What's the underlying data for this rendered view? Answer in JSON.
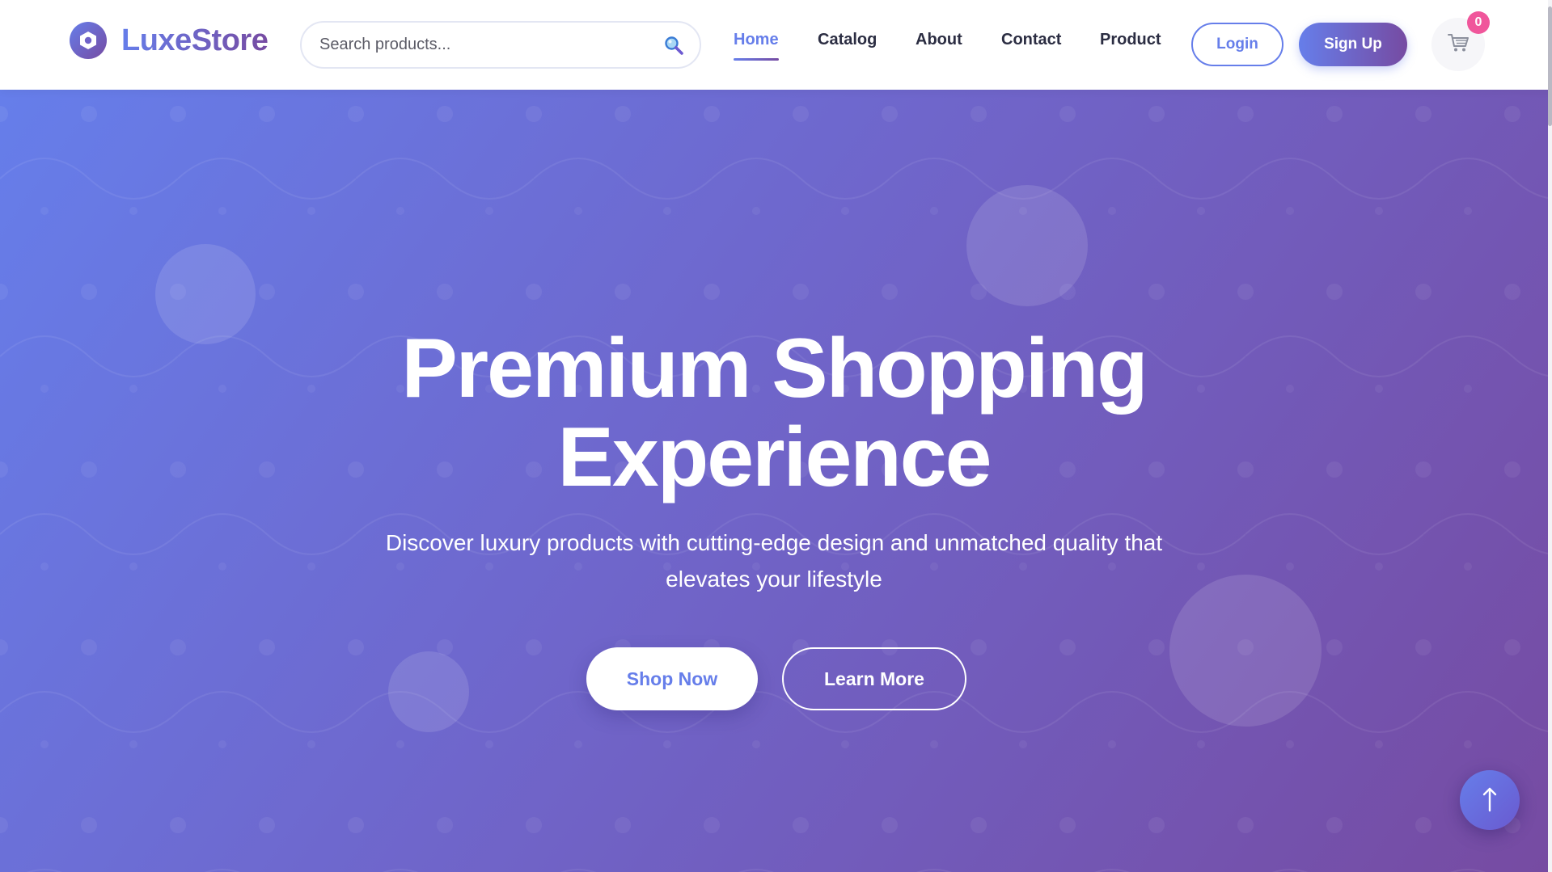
{
  "brand": {
    "name": "LuxeStore",
    "logo_icon": "hexagon-nut-icon",
    "gradient_start": "#667eea",
    "gradient_end": "#764ba2"
  },
  "search": {
    "placeholder": "Search products...",
    "value": "",
    "icon": "search-icon"
  },
  "nav": {
    "items": [
      {
        "label": "Home",
        "active": true
      },
      {
        "label": "Catalog",
        "active": false
      },
      {
        "label": "About",
        "active": false
      },
      {
        "label": "Contact",
        "active": false
      },
      {
        "label": "Product",
        "active": false
      }
    ]
  },
  "auth": {
    "login_label": "Login",
    "signup_label": "Sign Up"
  },
  "cart": {
    "icon": "cart-icon",
    "count": "0",
    "badge_color": "#f0569b"
  },
  "hero": {
    "title_line1": "Premium Shopping",
    "title_line2": "Experience",
    "subtitle": "Discover luxury products with cutting-edge design and unmatched quality that elevates your lifestyle",
    "primary_cta": "Shop Now",
    "secondary_cta": "Learn More",
    "background_start": "#667eea",
    "background_end": "#764ba2"
  },
  "scroll_to_top": {
    "icon": "arrow-up-icon"
  }
}
